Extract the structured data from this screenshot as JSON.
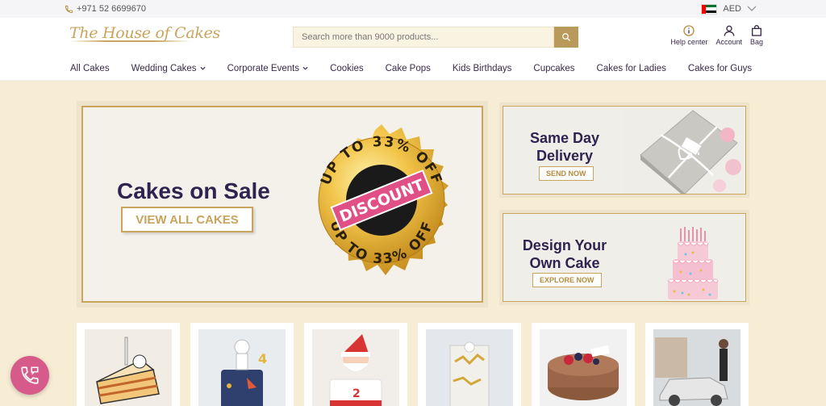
{
  "topbar": {
    "phone": "+971 52 6699670",
    "currency": "AED"
  },
  "header": {
    "logo_text": "The House of Cakes",
    "search_placeholder": "Search more than 9000 products...",
    "help_label": "Help center",
    "account_label": "Account",
    "bag_label": "Bag"
  },
  "nav": {
    "items": [
      {
        "label": "All Cakes",
        "dropdown": false
      },
      {
        "label": "Wedding Cakes",
        "dropdown": true
      },
      {
        "label": "Corporate Events",
        "dropdown": true
      },
      {
        "label": "Cookies",
        "dropdown": false
      },
      {
        "label": "Cake Pops",
        "dropdown": false
      },
      {
        "label": "Kids Birthdays",
        "dropdown": false
      },
      {
        "label": "Cupcakes",
        "dropdown": false
      },
      {
        "label": "Cakes for Ladies",
        "dropdown": false
      },
      {
        "label": "Cakes for Guys",
        "dropdown": false
      }
    ]
  },
  "hero": {
    "title": "Cakes on Sale",
    "button": "VIEW ALL CAKES",
    "seal_ring_text": "UP TO 33% OFF",
    "seal_ribbon": "DISCOUNT"
  },
  "promos": [
    {
      "title_line1": "Same Day",
      "title_line2": "Delivery",
      "button": "SEND NOW"
    },
    {
      "title_line1": "Design Your",
      "title_line2": "Own Cake",
      "button": "EXPLORE NOW"
    }
  ],
  "colors": {
    "accent_gold": "#c9a45c",
    "brand_purple": "#2f2350",
    "chat_pink": "#d65a8a",
    "page_bg": "#f7ecd4"
  }
}
